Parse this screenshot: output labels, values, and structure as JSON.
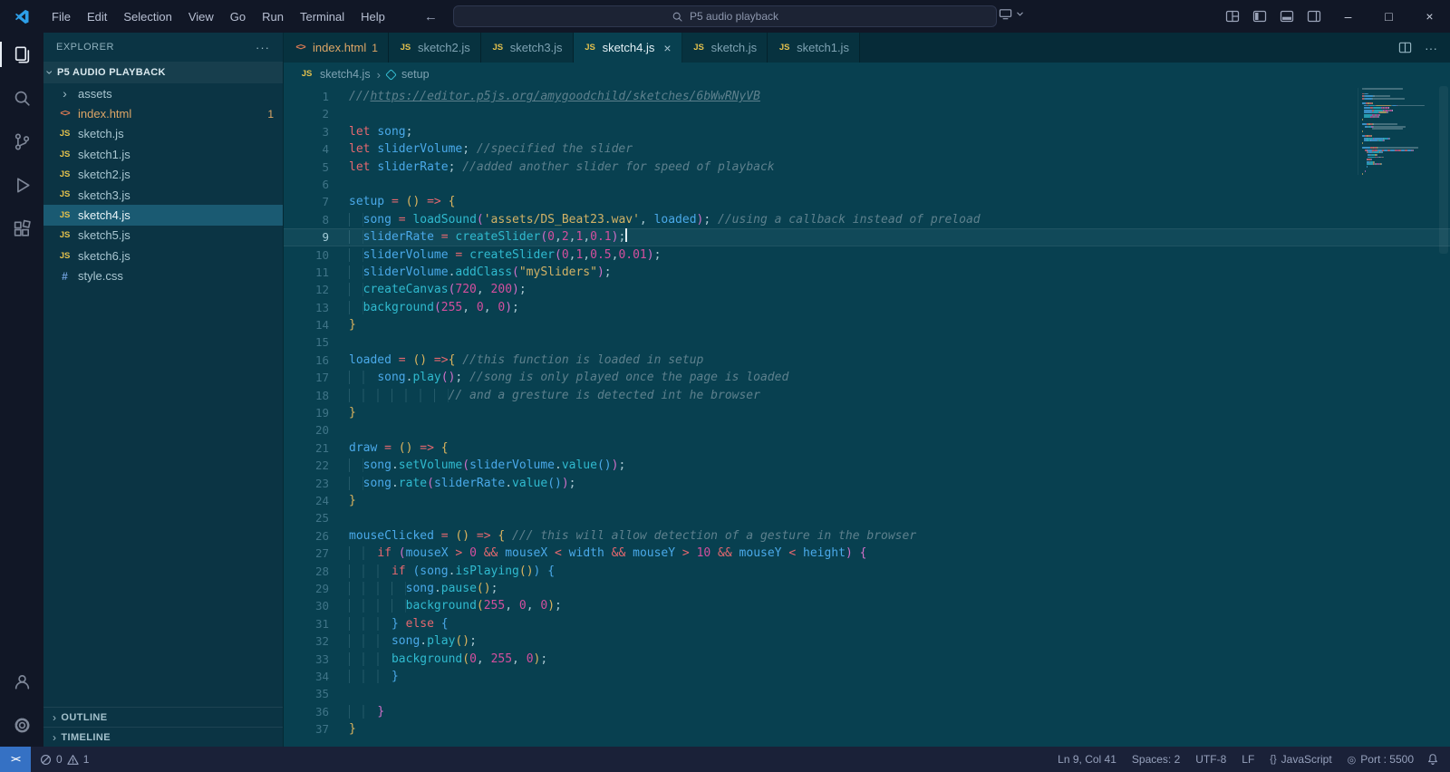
{
  "colors": {
    "titlebar": "#111726",
    "activitybar": "#111726",
    "statusbar": "#1a2138",
    "sidebar": "#0b3444",
    "editor": "#084050",
    "tabstrip": "#062b38",
    "tab_inactive": "#07323f",
    "selection": "#1a5a72",
    "accent": "#3571c4",
    "modified": "#dca566"
  },
  "window": {
    "menus": [
      "File",
      "Edit",
      "Selection",
      "View",
      "Go",
      "Run",
      "Terminal",
      "Help"
    ],
    "command_center": "P5 audio playback"
  },
  "icons": {
    "js": "JS",
    "html": "<>",
    "css": "#",
    "chevron": "›",
    "braces-icon": "{}",
    "broadcast-icon": "◎",
    "ellipsis": "···",
    "close": "×",
    "back": "←",
    "forward": "→",
    "minimize": "–",
    "maximize": "□",
    "remote": "><"
  },
  "explorer": {
    "title": "EXPLORER",
    "folder": "P5 AUDIO PLAYBACK",
    "files": [
      {
        "name": "assets",
        "icon": "folder"
      },
      {
        "name": "index.html",
        "icon": "html",
        "badge": "1",
        "modified": true
      },
      {
        "name": "sketch.js",
        "icon": "js"
      },
      {
        "name": "sketch1.js",
        "icon": "js"
      },
      {
        "name": "sketch2.js",
        "icon": "js"
      },
      {
        "name": "sketch3.js",
        "icon": "js"
      },
      {
        "name": "sketch4.js",
        "icon": "js",
        "selected": true
      },
      {
        "name": "sketch5.js",
        "icon": "js"
      },
      {
        "name": "sketch6.js",
        "icon": "js"
      },
      {
        "name": "style.css",
        "icon": "css"
      }
    ],
    "sections": [
      "OUTLINE",
      "TIMELINE"
    ]
  },
  "tabs": [
    {
      "label": "index.html",
      "icon": "html",
      "badge": "1",
      "modified": true
    },
    {
      "label": "sketch2.js",
      "icon": "js"
    },
    {
      "label": "sketch3.js",
      "icon": "js"
    },
    {
      "label": "sketch4.js",
      "icon": "js",
      "active": true
    },
    {
      "label": "sketch.js",
      "icon": "js"
    },
    {
      "label": "sketch1.js",
      "icon": "js"
    }
  ],
  "breadcrumb": {
    "file": "sketch4.js",
    "symbol": "setup"
  },
  "editor": {
    "cursor_line": 9,
    "lines": [
      {
        "n": 1,
        "t": [
          [
            "c",
            "///"
          ],
          [
            "cl",
            "https://editor.p5js.org/amygoodchild/sketches/6bWwRNyVB"
          ]
        ]
      },
      {
        "n": 2,
        "t": []
      },
      {
        "n": 3,
        "t": [
          [
            "k",
            "let"
          ],
          [
            "p",
            " "
          ],
          [
            "v",
            "song"
          ],
          [
            "p",
            ";"
          ]
        ]
      },
      {
        "n": 4,
        "t": [
          [
            "k",
            "let"
          ],
          [
            "p",
            " "
          ],
          [
            "v",
            "sliderVolume"
          ],
          [
            "p",
            "; "
          ],
          [
            "c",
            "//specified the slider"
          ]
        ]
      },
      {
        "n": 5,
        "t": [
          [
            "k",
            "let"
          ],
          [
            "p",
            " "
          ],
          [
            "v",
            "sliderRate"
          ],
          [
            "p",
            "; "
          ],
          [
            "c",
            "//added another slider for speed of playback"
          ]
        ]
      },
      {
        "n": 6,
        "t": []
      },
      {
        "n": 7,
        "t": [
          [
            "v",
            "setup"
          ],
          [
            "k",
            " = "
          ],
          [
            "b1",
            "()"
          ],
          [
            "k",
            " => "
          ],
          [
            "b1",
            "{"
          ]
        ]
      },
      {
        "n": 8,
        "t": [
          [
            "i",
            "  "
          ],
          [
            "v",
            "song"
          ],
          [
            "k",
            " = "
          ],
          [
            "f",
            "loadSound"
          ],
          [
            "b2",
            "("
          ],
          [
            "s",
            "'assets/DS_Beat23.wav'"
          ],
          [
            "p",
            ", "
          ],
          [
            "v",
            "loaded"
          ],
          [
            "b2",
            ")"
          ],
          [
            "p",
            "; "
          ],
          [
            "c",
            "//using a callback instead of preload"
          ]
        ]
      },
      {
        "n": 9,
        "t": [
          [
            "i",
            "  "
          ],
          [
            "v",
            "sliderRate"
          ],
          [
            "k",
            " = "
          ],
          [
            "f",
            "createSlider"
          ],
          [
            "b2",
            "("
          ],
          [
            "n",
            "0"
          ],
          [
            "p",
            ","
          ],
          [
            "n",
            "2"
          ],
          [
            "p",
            ","
          ],
          [
            "n",
            "1"
          ],
          [
            "p",
            ","
          ],
          [
            "n",
            "0.1"
          ],
          [
            "b2",
            ")"
          ],
          [
            "p",
            ";"
          ]
        ]
      },
      {
        "n": 10,
        "t": [
          [
            "i",
            "  "
          ],
          [
            "v",
            "sliderVolume"
          ],
          [
            "k",
            " = "
          ],
          [
            "f",
            "createSlider"
          ],
          [
            "b2",
            "("
          ],
          [
            "n",
            "0"
          ],
          [
            "p",
            ","
          ],
          [
            "n",
            "1"
          ],
          [
            "p",
            ","
          ],
          [
            "n",
            "0.5"
          ],
          [
            "p",
            ","
          ],
          [
            "n",
            "0.01"
          ],
          [
            "b2",
            ")"
          ],
          [
            "p",
            ";"
          ]
        ]
      },
      {
        "n": 11,
        "t": [
          [
            "i",
            "  "
          ],
          [
            "v",
            "sliderVolume"
          ],
          [
            "p",
            "."
          ],
          [
            "f",
            "addClass"
          ],
          [
            "b2",
            "("
          ],
          [
            "s",
            "\"mySliders\""
          ],
          [
            "b2",
            ")"
          ],
          [
            "p",
            ";"
          ]
        ]
      },
      {
        "n": 12,
        "t": [
          [
            "i",
            "  "
          ],
          [
            "f",
            "createCanvas"
          ],
          [
            "b2",
            "("
          ],
          [
            "n",
            "720"
          ],
          [
            "p",
            ", "
          ],
          [
            "n",
            "200"
          ],
          [
            "b2",
            ")"
          ],
          [
            "p",
            ";"
          ]
        ]
      },
      {
        "n": 13,
        "t": [
          [
            "i",
            "  "
          ],
          [
            "f",
            "background"
          ],
          [
            "b2",
            "("
          ],
          [
            "n",
            "255"
          ],
          [
            "p",
            ", "
          ],
          [
            "n",
            "0"
          ],
          [
            "p",
            ", "
          ],
          [
            "n",
            "0"
          ],
          [
            "b2",
            ")"
          ],
          [
            "p",
            ";"
          ]
        ]
      },
      {
        "n": 14,
        "t": [
          [
            "b1",
            "}"
          ]
        ]
      },
      {
        "n": 15,
        "t": []
      },
      {
        "n": 16,
        "t": [
          [
            "v",
            "loaded"
          ],
          [
            "k",
            " = "
          ],
          [
            "b1",
            "()"
          ],
          [
            "k",
            " =>"
          ],
          [
            "b1",
            "{"
          ],
          [
            "p",
            " "
          ],
          [
            "c",
            "//this function is loaded in setup"
          ]
        ]
      },
      {
        "n": 17,
        "t": [
          [
            "i",
            "    "
          ],
          [
            "v",
            "song"
          ],
          [
            "p",
            "."
          ],
          [
            "f",
            "play"
          ],
          [
            "b2",
            "()"
          ],
          [
            "p",
            "; "
          ],
          [
            "c",
            "//song is only played once the page is loaded"
          ]
        ]
      },
      {
        "n": 18,
        "t": [
          [
            "i",
            "              "
          ],
          [
            "c",
            "// and a gresture is detected int he browser"
          ]
        ]
      },
      {
        "n": 19,
        "t": [
          [
            "b1",
            "}"
          ]
        ]
      },
      {
        "n": 20,
        "t": []
      },
      {
        "n": 21,
        "t": [
          [
            "v",
            "draw"
          ],
          [
            "k",
            " = "
          ],
          [
            "b1",
            "()"
          ],
          [
            "k",
            " => "
          ],
          [
            "b1",
            "{"
          ]
        ]
      },
      {
        "n": 22,
        "t": [
          [
            "i",
            "  "
          ],
          [
            "v",
            "song"
          ],
          [
            "p",
            "."
          ],
          [
            "f",
            "setVolume"
          ],
          [
            "b2",
            "("
          ],
          [
            "v",
            "sliderVolume"
          ],
          [
            "p",
            "."
          ],
          [
            "f",
            "value"
          ],
          [
            "b3",
            "()"
          ],
          [
            "b2",
            ")"
          ],
          [
            "p",
            ";"
          ]
        ]
      },
      {
        "n": 23,
        "t": [
          [
            "i",
            "  "
          ],
          [
            "v",
            "song"
          ],
          [
            "p",
            "."
          ],
          [
            "f",
            "rate"
          ],
          [
            "b2",
            "("
          ],
          [
            "v",
            "sliderRate"
          ],
          [
            "p",
            "."
          ],
          [
            "f",
            "value"
          ],
          [
            "b3",
            "()"
          ],
          [
            "b2",
            ")"
          ],
          [
            "p",
            ";"
          ]
        ]
      },
      {
        "n": 24,
        "t": [
          [
            "b1",
            "}"
          ]
        ]
      },
      {
        "n": 25,
        "t": []
      },
      {
        "n": 26,
        "t": [
          [
            "v",
            "mouseClicked"
          ],
          [
            "k",
            " = "
          ],
          [
            "b1",
            "()"
          ],
          [
            "k",
            " => "
          ],
          [
            "b1",
            "{"
          ],
          [
            "p",
            " "
          ],
          [
            "c",
            "/// this will allow detection of a gesture in the browser"
          ]
        ]
      },
      {
        "n": 27,
        "t": [
          [
            "i",
            "    "
          ],
          [
            "k",
            "if"
          ],
          [
            "p",
            " "
          ],
          [
            "b2",
            "("
          ],
          [
            "v",
            "mouseX"
          ],
          [
            "k",
            " > "
          ],
          [
            "n",
            "0"
          ],
          [
            "k",
            " && "
          ],
          [
            "v",
            "mouseX"
          ],
          [
            "k",
            " < "
          ],
          [
            "v",
            "width"
          ],
          [
            "k",
            " && "
          ],
          [
            "v",
            "mouseY"
          ],
          [
            "k",
            " > "
          ],
          [
            "n",
            "10"
          ],
          [
            "k",
            " && "
          ],
          [
            "v",
            "mouseY"
          ],
          [
            "k",
            " < "
          ],
          [
            "v",
            "height"
          ],
          [
            "b2",
            ")"
          ],
          [
            "p",
            " "
          ],
          [
            "b2",
            "{"
          ]
        ]
      },
      {
        "n": 28,
        "t": [
          [
            "i",
            "      "
          ],
          [
            "k",
            "if"
          ],
          [
            "p",
            " "
          ],
          [
            "b3",
            "("
          ],
          [
            "v",
            "song"
          ],
          [
            "p",
            "."
          ],
          [
            "f",
            "isPlaying"
          ],
          [
            "b1",
            "()"
          ],
          [
            "b3",
            ")"
          ],
          [
            "p",
            " "
          ],
          [
            "b3",
            "{"
          ]
        ]
      },
      {
        "n": 29,
        "t": [
          [
            "i",
            "        "
          ],
          [
            "v",
            "song"
          ],
          [
            "p",
            "."
          ],
          [
            "f",
            "pause"
          ],
          [
            "b1",
            "()"
          ],
          [
            "p",
            ";"
          ]
        ]
      },
      {
        "n": 30,
        "t": [
          [
            "i",
            "        "
          ],
          [
            "f",
            "background"
          ],
          [
            "b1",
            "("
          ],
          [
            "n",
            "255"
          ],
          [
            "p",
            ", "
          ],
          [
            "n",
            "0"
          ],
          [
            "p",
            ", "
          ],
          [
            "n",
            "0"
          ],
          [
            "b1",
            ")"
          ],
          [
            "p",
            ";"
          ]
        ]
      },
      {
        "n": 31,
        "t": [
          [
            "i",
            "      "
          ],
          [
            "b3",
            "}"
          ],
          [
            "k",
            " else "
          ],
          [
            "b3",
            "{"
          ]
        ]
      },
      {
        "n": 32,
        "t": [
          [
            "i",
            "      "
          ],
          [
            "v",
            "song"
          ],
          [
            "p",
            "."
          ],
          [
            "f",
            "play"
          ],
          [
            "b1",
            "()"
          ],
          [
            "p",
            ";"
          ]
        ]
      },
      {
        "n": 33,
        "t": [
          [
            "i",
            "      "
          ],
          [
            "f",
            "background"
          ],
          [
            "b1",
            "("
          ],
          [
            "n",
            "0"
          ],
          [
            "p",
            ", "
          ],
          [
            "n",
            "255"
          ],
          [
            "p",
            ", "
          ],
          [
            "n",
            "0"
          ],
          [
            "b1",
            ")"
          ],
          [
            "p",
            ";"
          ]
        ]
      },
      {
        "n": 34,
        "t": [
          [
            "i",
            "      "
          ],
          [
            "b3",
            "}"
          ]
        ]
      },
      {
        "n": 35,
        "t": []
      },
      {
        "n": 36,
        "t": [
          [
            "i",
            "    "
          ],
          [
            "b2",
            "}"
          ]
        ]
      },
      {
        "n": 37,
        "t": [
          [
            "b1",
            "}"
          ]
        ]
      }
    ]
  },
  "status_bar": {
    "errors": "0",
    "warnings": "1",
    "right": [
      {
        "label": "Ln 9, Col 41"
      },
      {
        "label": "Spaces: 2"
      },
      {
        "label": "UTF-8"
      },
      {
        "label": "LF"
      },
      {
        "label": "JavaScript",
        "icon": "braces-icon"
      },
      {
        "label": "Port : 5500",
        "icon": "broadcast-icon"
      }
    ]
  }
}
